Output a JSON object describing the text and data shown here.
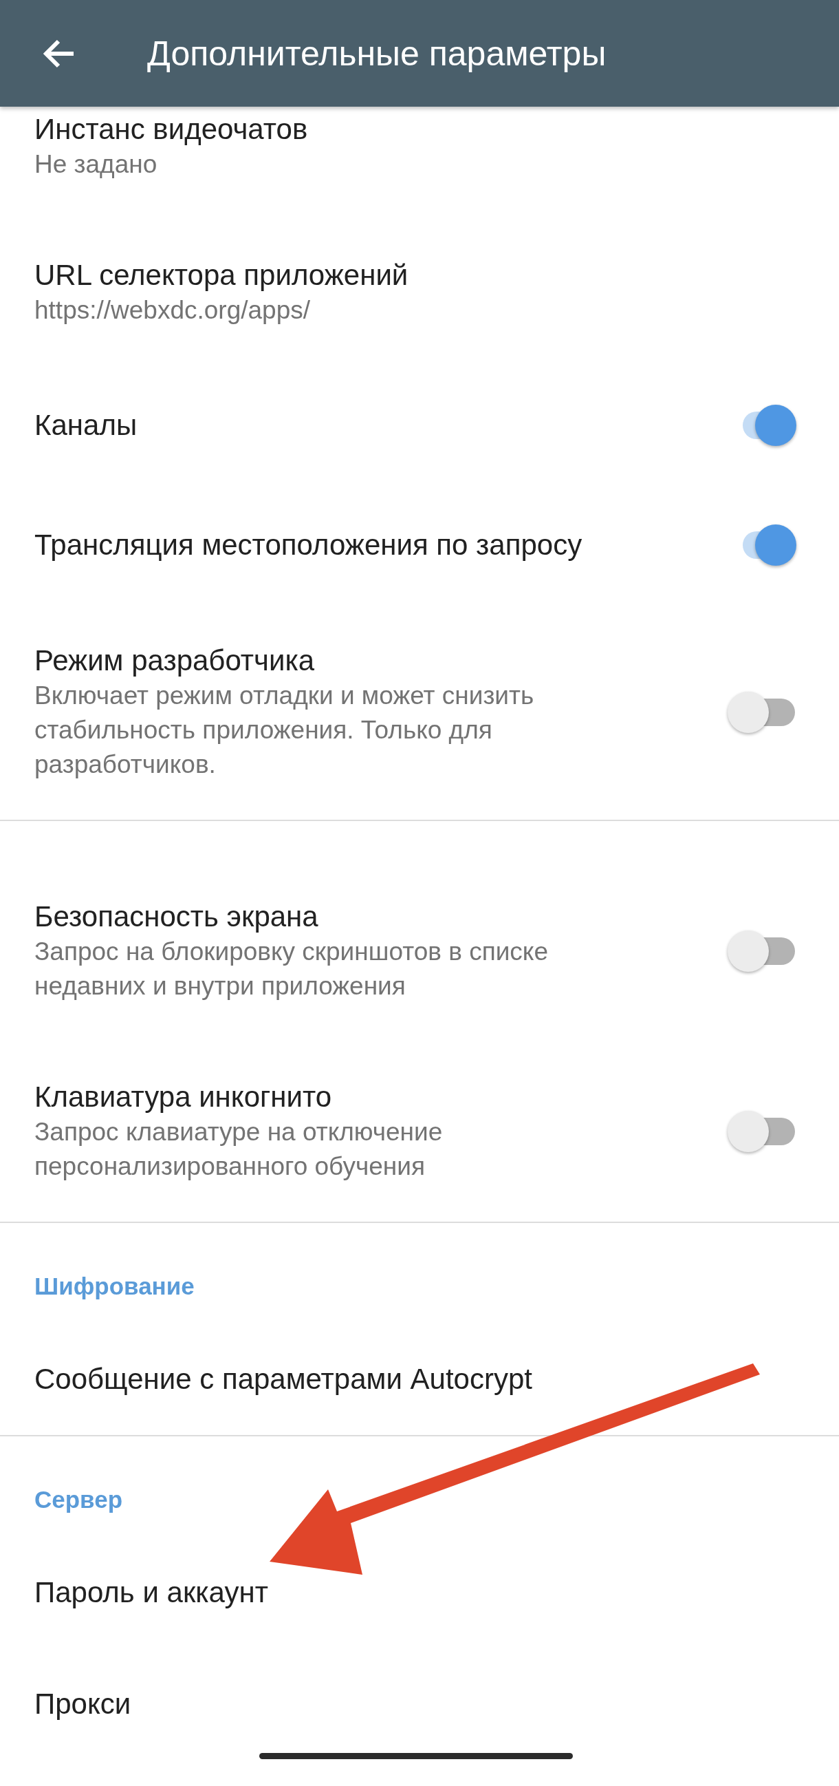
{
  "app_bar": {
    "title": "Дополнительные параметры"
  },
  "sections": [
    {
      "items": [
        {
          "kind": "text",
          "title": "Инстанс видеочатов",
          "summary": "Не задано"
        },
        {
          "kind": "text",
          "title": "URL селектора приложений",
          "summary": "https://webxdc.org/apps/"
        },
        {
          "kind": "switch",
          "title": "Каналы",
          "on": true
        },
        {
          "kind": "switch",
          "title": "Трансляция местоположения по запросу",
          "on": true
        },
        {
          "kind": "switch",
          "title": "Режим разработчика",
          "summary": "Включает режим отладки и может снизить стабильность приложения. Только для разработчиков.",
          "on": false
        }
      ]
    },
    {
      "items": [
        {
          "kind": "switch",
          "title": "Безопасность экрана",
          "summary": "Запрос на блокировку скриншотов в списке недавних и внутри приложения",
          "on": false
        },
        {
          "kind": "switch",
          "title": "Клавиатура инкогнито",
          "summary": "Запрос клавиатуре на отключение персонализированного обучения",
          "on": false
        }
      ]
    },
    {
      "header": "Шифрование",
      "items": [
        {
          "kind": "text",
          "title": "Сообщение с параметрами Autocrypt"
        }
      ]
    },
    {
      "header": "Сервер",
      "items": [
        {
          "kind": "text",
          "title": "Пароль и аккаунт"
        },
        {
          "kind": "text",
          "title": "Прокси"
        }
      ]
    }
  ]
}
